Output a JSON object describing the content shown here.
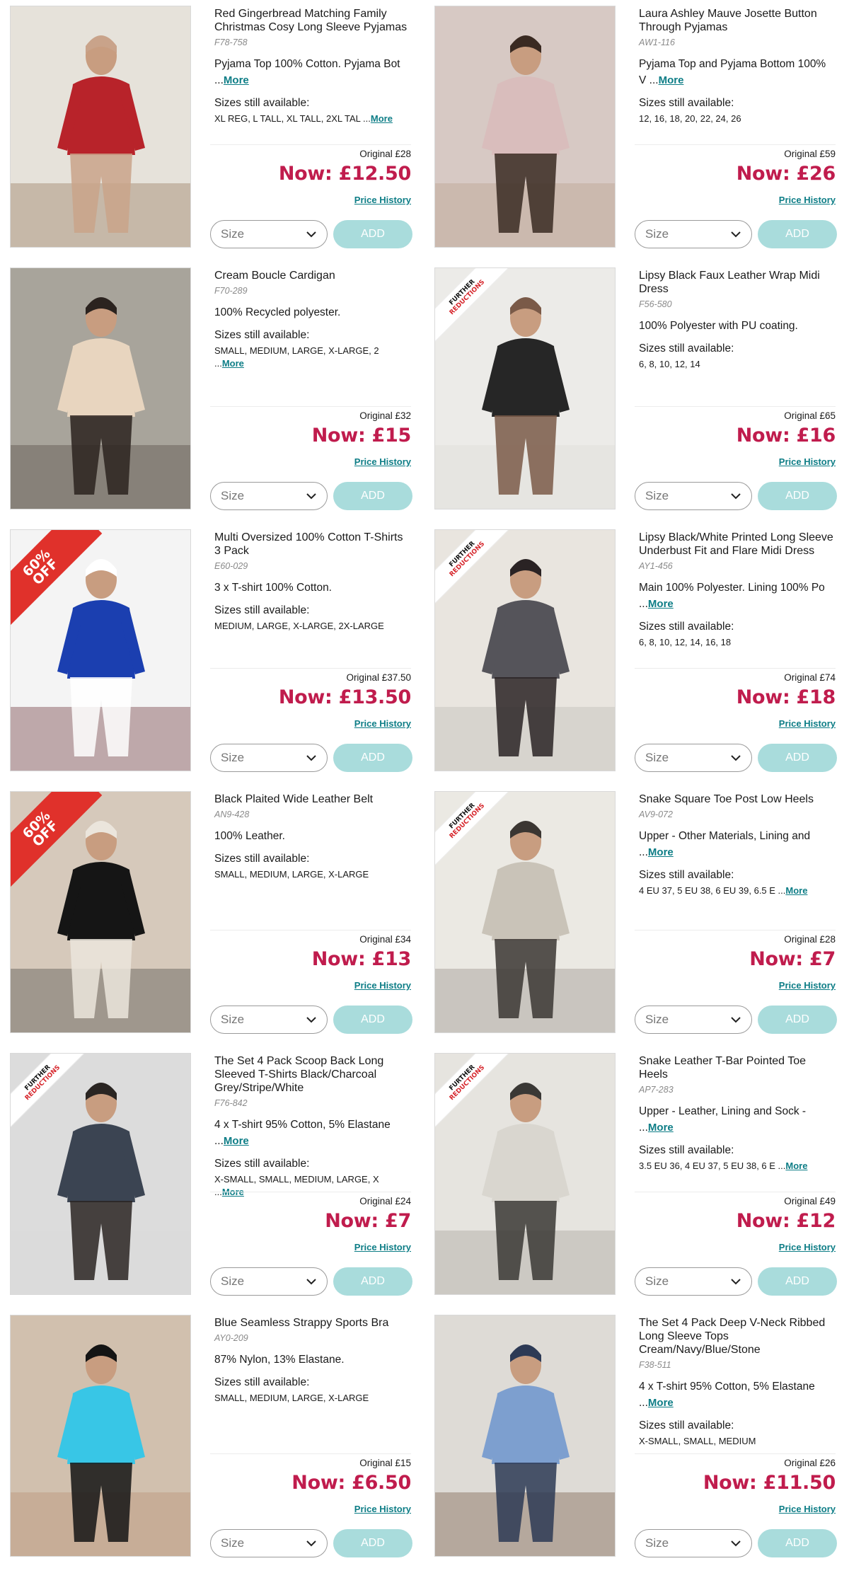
{
  "labels": {
    "sizes_heading": "Sizes still available:",
    "more": "More",
    "size_placeholder": "Size",
    "add": "ADD",
    "price_history": "Price History"
  },
  "products": [
    {
      "title": "Red Gingerbread Matching Family Christmas Cosy Long Sleeve Pyjamas",
      "code": "F78-758",
      "desc": "Pyjama Top 100% Cotton. Pyjama Bot ...",
      "desc_more": true,
      "sizes": "XL REG, L TALL, XL TALL, 2XL TAL ...",
      "sizes_more": true,
      "original": "Original £28",
      "now": "Now: £12.50",
      "badge": "",
      "colors": [
        "#e6e2da",
        "#b8232a",
        "#c9a38a",
        "#8a6a4a"
      ]
    },
    {
      "title": "Laura Ashley Mauve Josette Button Through Pyjamas",
      "code": "AW1-116",
      "desc": "Pyjama Top and Pyjama Bottom 100% V ...",
      "desc_more": true,
      "sizes": "12, 16, 18, 20, 22, 24, 26",
      "sizes_more": false,
      "original": "Original £59",
      "now": "Now: £26",
      "badge": "",
      "colors": [
        "#d7c9c4",
        "#d9bdbc",
        "#3a2a22",
        "#b49a86"
      ]
    },
    {
      "title": "Cream Boucle Cardigan",
      "code": "F70-289",
      "desc": "100% Recycled polyester.",
      "desc_more": false,
      "sizes": "SMALL, MEDIUM, LARGE, X-LARGE, 2 ...",
      "sizes_more": true,
      "original": "Original £32",
      "now": "Now: £15",
      "badge": "",
      "colors": [
        "#a8a49b",
        "#e8d5bf",
        "#2b231f",
        "#4a4138"
      ]
    },
    {
      "title": "Lipsy Black Faux Leather Wrap Midi Dress",
      "code": "F56-580",
      "desc": "100% Polyester with PU coating.",
      "desc_more": false,
      "sizes": "6, 8, 10, 12, 14",
      "sizes_more": false,
      "original": "Original £65",
      "now": "Now: £16",
      "badge": "further",
      "colors": [
        "#ecebe8",
        "#262626",
        "#7a5a48",
        "#dcdad5"
      ]
    },
    {
      "title": "Multi Oversized 100% Cotton T-Shirts 3 Pack",
      "code": "E60-029",
      "desc": "3 x T-shirt 100% Cotton.",
      "desc_more": false,
      "sizes": "MEDIUM, LARGE, X-LARGE, 2X-LARGE",
      "sizes_more": false,
      "original": "Original £37.50",
      "now": "Now: £13.50",
      "badge": "pct",
      "colors": [
        "#f4f4f4",
        "#1b3fb0",
        "#ffffff",
        "#5a1a20"
      ]
    },
    {
      "title": "Lipsy Black/White Printed Long Sleeve Underbust Fit and Flare Midi Dress",
      "code": "AY1-456",
      "desc": "Main 100% Polyester. Lining 100% Po ...",
      "desc_more": true,
      "sizes": "6, 8, 10, 12, 14, 16, 18",
      "sizes_more": false,
      "original": "Original £74",
      "now": "Now: £18",
      "badge": "further",
      "colors": [
        "#e9e5df",
        "#55545a",
        "#2a2324",
        "#b8b4b0"
      ]
    },
    {
      "title": "Black Plaited Wide Leather Belt",
      "code": "AN9-428",
      "desc": "100% Leather.",
      "desc_more": false,
      "sizes": "SMALL, MEDIUM, LARGE, X-LARGE",
      "sizes_more": false,
      "original": "Original £34",
      "now": "Now: £13",
      "badge": "pct",
      "colors": [
        "#d6c9bb",
        "#151515",
        "#ebe5dc",
        "#3a3a3a"
      ]
    },
    {
      "title": "Snake Square Toe Post Low Heels",
      "code": "AV9-072",
      "desc": "Upper - Other Materials, Lining and ...",
      "desc_more": true,
      "sizes": "4 EU 37, 5 EU 38, 6 EU 39, 6.5 E ...",
      "sizes_more": true,
      "original": "Original £28",
      "now": "Now: £7",
      "badge": "further",
      "colors": [
        "#ebe9e3",
        "#c9c3b8",
        "#3b3632",
        "#8a847a"
      ]
    },
    {
      "title": "The Set 4 Pack Scoop Back Long Sleeved T-Shirts Black/Charcoal Grey/Stripe/White",
      "code": "F76-842",
      "desc": "4 x T-shirt 95% Cotton, 5% Elastane ...",
      "desc_more": true,
      "sizes": "X-SMALL, SMALL, MEDIUM, LARGE, X ...",
      "sizes_more": true,
      "original": "Original £24",
      "now": "Now: £7",
      "badge": "further",
      "colors": [
        "#dcdcdc",
        "#3b4452",
        "#2a2522",
        "#d9d9d9"
      ]
    },
    {
      "title": "Snake Leather T-Bar Pointed Toe Heels",
      "code": "AP7-283",
      "desc": "Upper - Leather, Lining and Sock - ...",
      "desc_more": true,
      "sizes": "3.5 EU 36, 4 EU 37, 5 EU 38, 6 E ...",
      "sizes_more": true,
      "original": "Original £49",
      "now": "Now: £12",
      "badge": "further",
      "colors": [
        "#e6e4df",
        "#d9d6cf",
        "#3a3835",
        "#9b978f"
      ]
    },
    {
      "title": "Blue Seamless Strappy Sports Bra",
      "code": "AY0-209",
      "desc": "87% Nylon, 13% Elastane.",
      "desc_more": false,
      "sizes": "SMALL, MEDIUM, LARGE, X-LARGE",
      "sizes_more": false,
      "original": "Original £15",
      "now": "Now: £6.50",
      "badge": "",
      "colors": [
        "#d1c0ae",
        "#38c6e6",
        "#141414",
        "#b58a6e"
      ]
    },
    {
      "title": "The Set 4 Pack Deep V-Neck Ribbed Long Sleeve Tops Cream/Navy/Blue/Stone",
      "code": "F38-511",
      "desc": "4 x T-shirt 95% Cotton, 5% Elastane ...",
      "desc_more": true,
      "sizes": "X-SMALL, SMALL, MEDIUM",
      "sizes_more": false,
      "original": "Original £26",
      "now": "Now: £11.50",
      "badge": "",
      "colors": [
        "#dedbd6",
        "#7d9fcf",
        "#2d3a55",
        "#6a4a35"
      ]
    }
  ],
  "badge_text": {
    "further_1": "FURTHER",
    "further_2": "REDUCTIONS",
    "pct_1": "60%",
    "pct_2": "OFF"
  }
}
